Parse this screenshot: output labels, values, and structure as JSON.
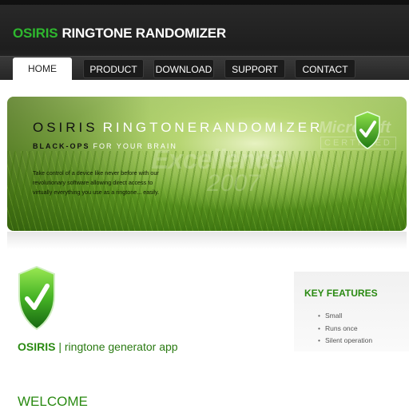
{
  "header": {
    "logo_brand": "OSIRIS",
    "logo_rest": "RINGTONE RANDOMIZER"
  },
  "nav": {
    "items": [
      {
        "label": "HOME",
        "active": true
      },
      {
        "label": "PRODUCT",
        "active": false
      },
      {
        "label": "DOWNLOAD",
        "active": false
      },
      {
        "label": "SUPPORT",
        "active": false
      },
      {
        "label": "CONTACT",
        "active": false
      }
    ]
  },
  "banner": {
    "title_brand": "OSIRIS",
    "title_rest": "RINGTONERANDOMIZER",
    "tag_bold": "BLACK-OPS",
    "tag_rest": "FOR YOUR BRAIN",
    "description": "Take control of a device like never before with our revolutionary software allowing direct access to virtually everything you use as a ringtone... easily.",
    "watermark_excellence": "Excellence",
    "watermark_year": "2007",
    "watermark_ms": "Microsoft",
    "watermark_cert": "CERTIFIED"
  },
  "product": {
    "name_bold": "OSIRIS",
    "name_rest": "| ringtone generator app"
  },
  "features": {
    "heading": "KEY FEATURES",
    "items": [
      "Small",
      "Runs once",
      "Silent operation"
    ]
  },
  "welcome": "WELCOME",
  "colors": {
    "accent_green": "#2a8a12",
    "header_dark": "#222222",
    "logo_green": "#2eb82e"
  },
  "icons": {
    "shield": "checkmark-shield-icon"
  }
}
